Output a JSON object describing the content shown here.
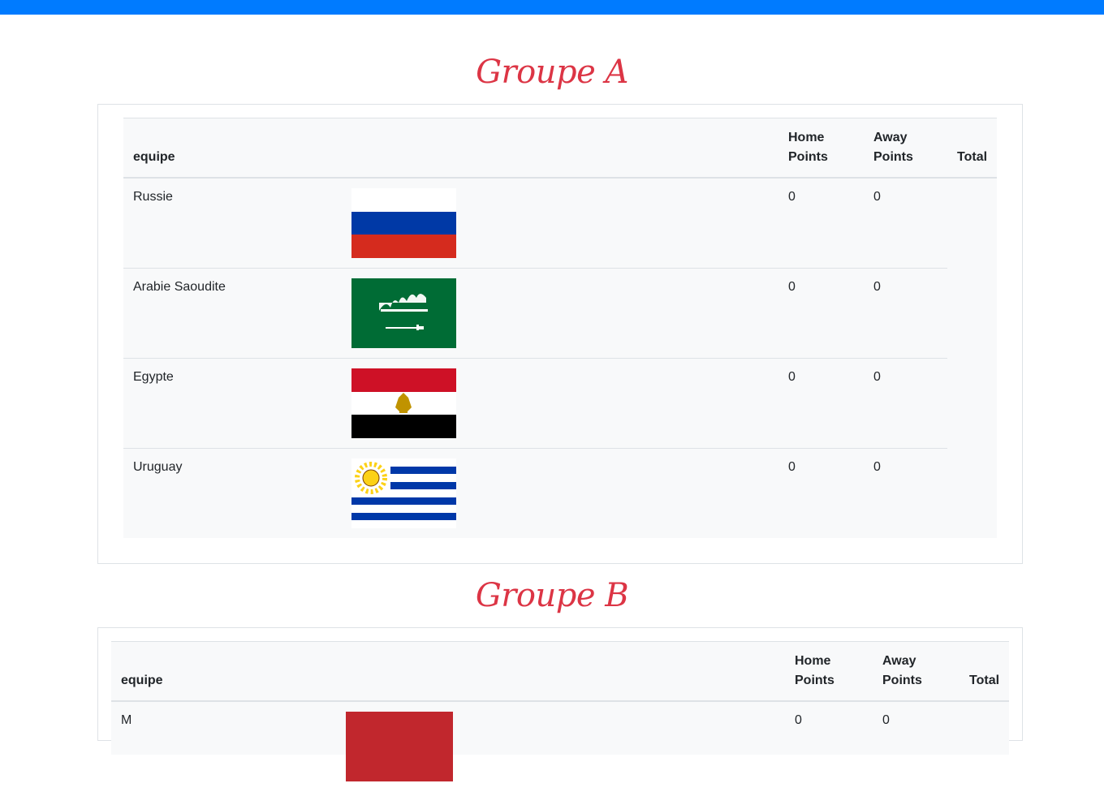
{
  "colors": {
    "topbar": "#007bff",
    "title": "#dc3545",
    "table_bg": "#f8f9fa",
    "border": "#dee2e6"
  },
  "groups": [
    {
      "title": "Groupe A",
      "headers": {
        "team": "equipe",
        "home": "Home Points",
        "away": "Away Points",
        "total": "Total"
      },
      "rows": [
        {
          "team": "Russie",
          "flag": "russia-flag-icon",
          "home": "0",
          "away": "0"
        },
        {
          "team": "Arabie Saoudite",
          "flag": "saudi-arabia-flag-icon",
          "home": "0",
          "away": "0"
        },
        {
          "team": "Egypte",
          "flag": "egypt-flag-icon",
          "home": "0",
          "away": "0"
        },
        {
          "team": "Uruguay",
          "flag": "uruguay-flag-icon",
          "home": "0",
          "away": "0"
        }
      ]
    },
    {
      "title": "Groupe B",
      "headers": {
        "team": "equipe",
        "home": "Home Points",
        "away": "Away Points",
        "total": "Total"
      },
      "rows": [
        {
          "team": "M",
          "home": "0",
          "away": "0"
        }
      ]
    }
  ]
}
